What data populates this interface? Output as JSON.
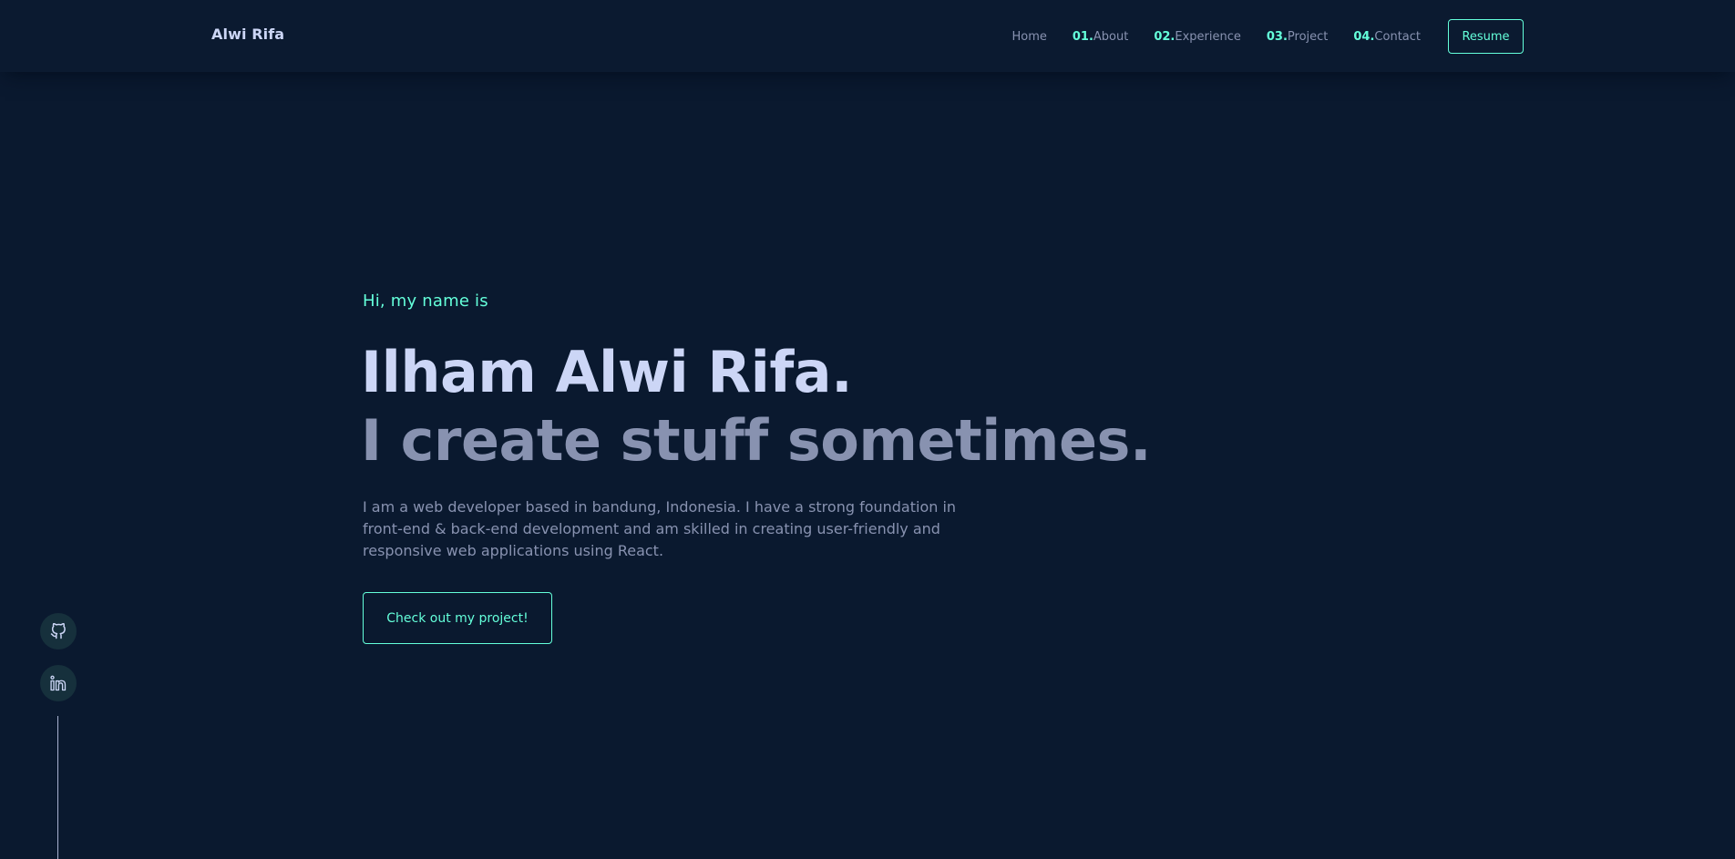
{
  "navbar": {
    "brand": "Alwi Rifa",
    "links": [
      {
        "num": "",
        "label": "Home"
      },
      {
        "num": "01.",
        "label": "About"
      },
      {
        "num": "02.",
        "label": "Experience"
      },
      {
        "num": "03.",
        "label": "Project"
      },
      {
        "num": "04.",
        "label": "Contact"
      }
    ],
    "resume_label": "Resume"
  },
  "hero": {
    "greeting": "Hi, my name is",
    "name": "Ilham Alwi Rifa.",
    "tagline": "I create stuff sometimes.",
    "description": "I am a web developer based in bandung, Indonesia. I have a strong foundation in front-end & back-end development and am skilled in creating user-friendly and responsive web applications using React.",
    "cta_label": "Check out my project!"
  },
  "social": {
    "icons": [
      "github-icon",
      "linkedin-icon"
    ]
  },
  "colors": {
    "background": "#0a192f",
    "accent": "#64ffda",
    "heading": "#ccd6f6",
    "muted": "#8892b0"
  }
}
